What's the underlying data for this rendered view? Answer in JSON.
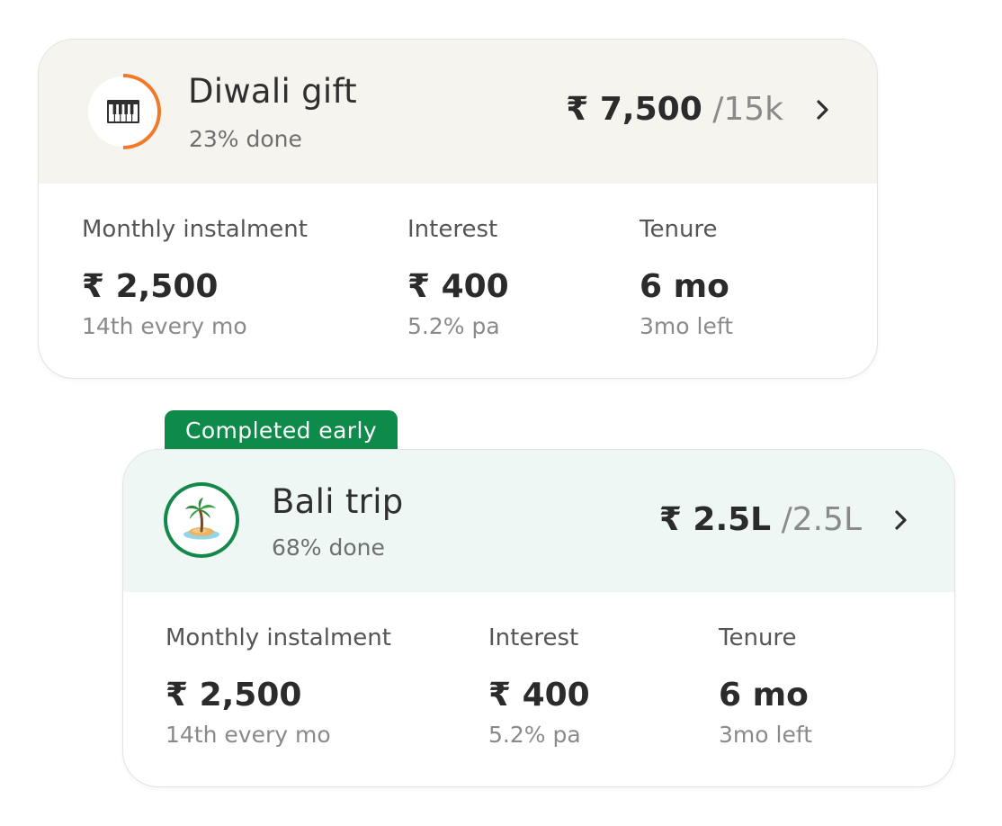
{
  "goals": [
    {
      "title": "Diwali gift",
      "progress_text": "23% done",
      "progress_fraction": 0.23,
      "icon": "piano-icon",
      "amount_saved": "₹ 7,500",
      "amount_target": "/15k",
      "stats": [
        {
          "label": "Monthly instalment",
          "value": "₹ 2,500",
          "sub": "14th every mo"
        },
        {
          "label": "Interest",
          "value": "₹ 400",
          "sub": "5.2% pa"
        },
        {
          "label": "Tenure",
          "value": "6 mo",
          "sub": "3mo left"
        }
      ],
      "colors": {
        "header_bg": "#f5f4ef",
        "ring": "#f07a2a"
      }
    },
    {
      "badge": "Completed early",
      "title": "Bali trip",
      "progress_text": "68% done",
      "progress_fraction": 1.0,
      "icon": "palm-island-icon",
      "amount_saved": "₹ 2.5L",
      "amount_target": "/2.5L",
      "stats": [
        {
          "label": "Monthly instalment",
          "value": "₹ 2,500",
          "sub": "14th every mo"
        },
        {
          "label": "Interest",
          "value": "₹ 400",
          "sub": "5.2% pa"
        },
        {
          "label": "Tenure",
          "value": "6 mo",
          "sub": "3mo left"
        }
      ],
      "colors": {
        "header_bg": "#eef7f3",
        "ring": "#14884a",
        "badge": "#0e8a4a"
      }
    }
  ]
}
